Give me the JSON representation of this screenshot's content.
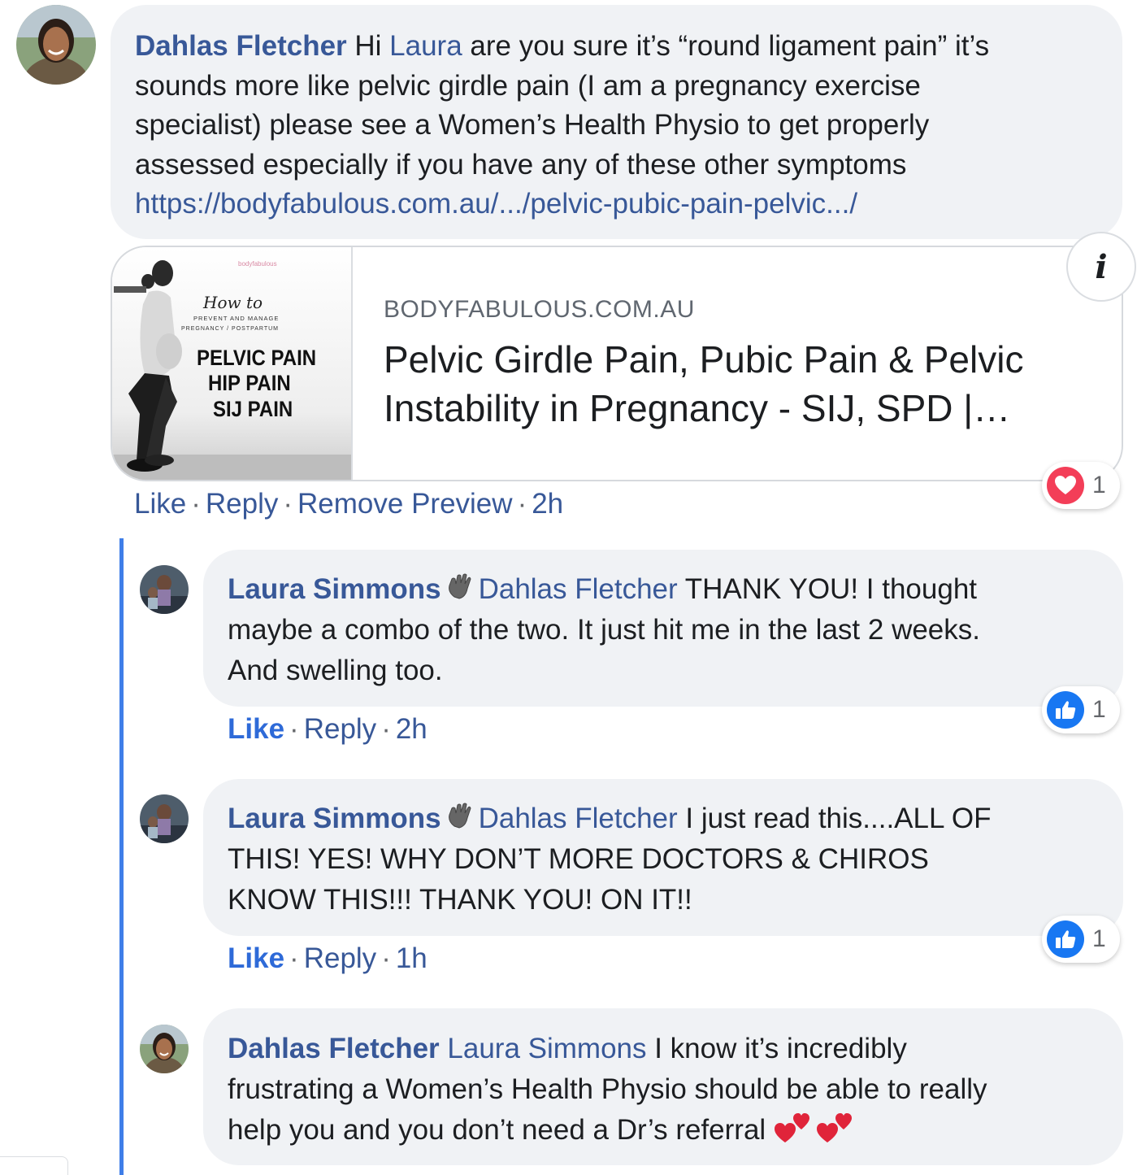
{
  "comment1": {
    "author": "Dahlas Fletcher",
    "text_pre": " Hi ",
    "mention": "Laura",
    "line1_rest": " are you sure it’s “round ligament pain” it’s",
    "line2": "sounds more like pelvic girdle pain (I am a pregnancy exercise",
    "line3": "specialist) please see a Women’s Health Physio to get properly",
    "line4": "assessed especially if you have any of these other symptoms",
    "link": "https://bodyfabulous.com.au/.../pelvic-pubic-pain-pelvic.../",
    "preview": {
      "domain": "BODYFABULOUS.COM.AU",
      "title": "Pelvic Girdle Pain, Pubic Pain & Pelvic Instability in Pregnancy - SIJ, SPD |…",
      "thumb_brand": "bodyfabulous",
      "thumb_howto": "How to",
      "thumb_sub1": "PREVENT AND MANAGE",
      "thumb_sub2": "PREGNANCY / POSTPARTUM",
      "thumb_line1": "PELVIC PAIN",
      "thumb_line2": "HIP PAIN",
      "thumb_line3": "SIJ PAIN",
      "info_label": "i"
    },
    "actions": {
      "like": "Like",
      "reply": "Reply",
      "remove": "Remove Preview",
      "time": "2h"
    },
    "reaction": {
      "type": "love",
      "count": "1",
      "color": "#f33e58"
    }
  },
  "reply1": {
    "author": "Laura Simmons",
    "mention": "Dahlas Fletcher",
    "line1_rest": " THANK YOU! I thought",
    "line2": "maybe a combo of the two. It just hit me in the last 2 weeks.",
    "line3": "And swelling too.",
    "actions": {
      "like": "Like",
      "reply": "Reply",
      "time": "2h"
    },
    "reaction": {
      "type": "like",
      "count": "1",
      "color": "#1877f2"
    }
  },
  "reply2": {
    "author": "Laura Simmons",
    "mention": "Dahlas Fletcher",
    "line1_rest": " I just read this....ALL OF",
    "line2": "THIS! YES! WHY DON’T MORE DOCTORS & CHIROS",
    "line3": "KNOW THIS!!! THANK YOU! ON IT!!",
    "actions": {
      "like": "Like",
      "reply": "Reply",
      "time": "1h"
    },
    "reaction": {
      "type": "like",
      "count": "1",
      "color": "#1877f2"
    }
  },
  "reply3": {
    "author": "Dahlas Fletcher",
    "mention": "Laura Simmons",
    "line1_rest": " I know it’s incredibly",
    "line2": "frustrating a Women’s Health Physio should be able to really",
    "line3": "help you and you don’t need a Dr’s referral "
  }
}
